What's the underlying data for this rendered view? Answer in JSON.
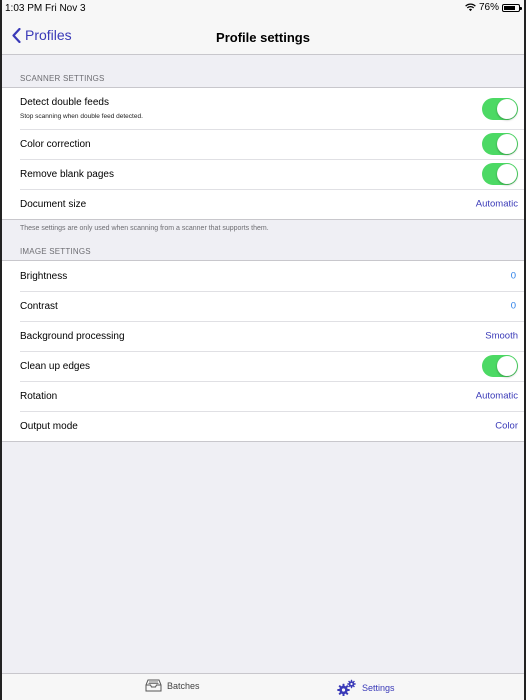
{
  "status": {
    "time": "1:03 PM  Fri Nov 3",
    "battery": "76%",
    "battery_level": 0.76
  },
  "nav": {
    "back_label": "Profiles",
    "title": "Profile settings"
  },
  "scanner_section": {
    "header": "SCANNER SETTINGS",
    "rows": [
      {
        "label": "Detect double feeds",
        "sub": "Stop scanning when double feed detected.",
        "toggle": true
      },
      {
        "label": "Color correction",
        "toggle": true
      },
      {
        "label": "Remove blank pages",
        "toggle": true
      },
      {
        "label": "Document size",
        "value": "Automatic"
      }
    ],
    "footer": "These settings are only used when scanning from a scanner that supports them."
  },
  "image_section": {
    "header": "IMAGE SETTINGS",
    "rows": [
      {
        "label": "Brightness",
        "value": "0"
      },
      {
        "label": "Contrast",
        "value": "0"
      },
      {
        "label": "Background processing",
        "value": "Smooth"
      },
      {
        "label": "Clean up edges",
        "toggle": true
      },
      {
        "label": "Rotation",
        "value": "Automatic"
      },
      {
        "label": "Output mode",
        "value": "Color"
      }
    ]
  },
  "tabs": [
    {
      "label": "Batches",
      "icon": "tray-icon",
      "active": false
    },
    {
      "label": "Settings",
      "icon": "gears-icon",
      "active": true
    }
  ],
  "colors": {
    "accent": "#3a3ab8",
    "toggle_on": "#4cd964",
    "number": "#2a7ee8"
  }
}
